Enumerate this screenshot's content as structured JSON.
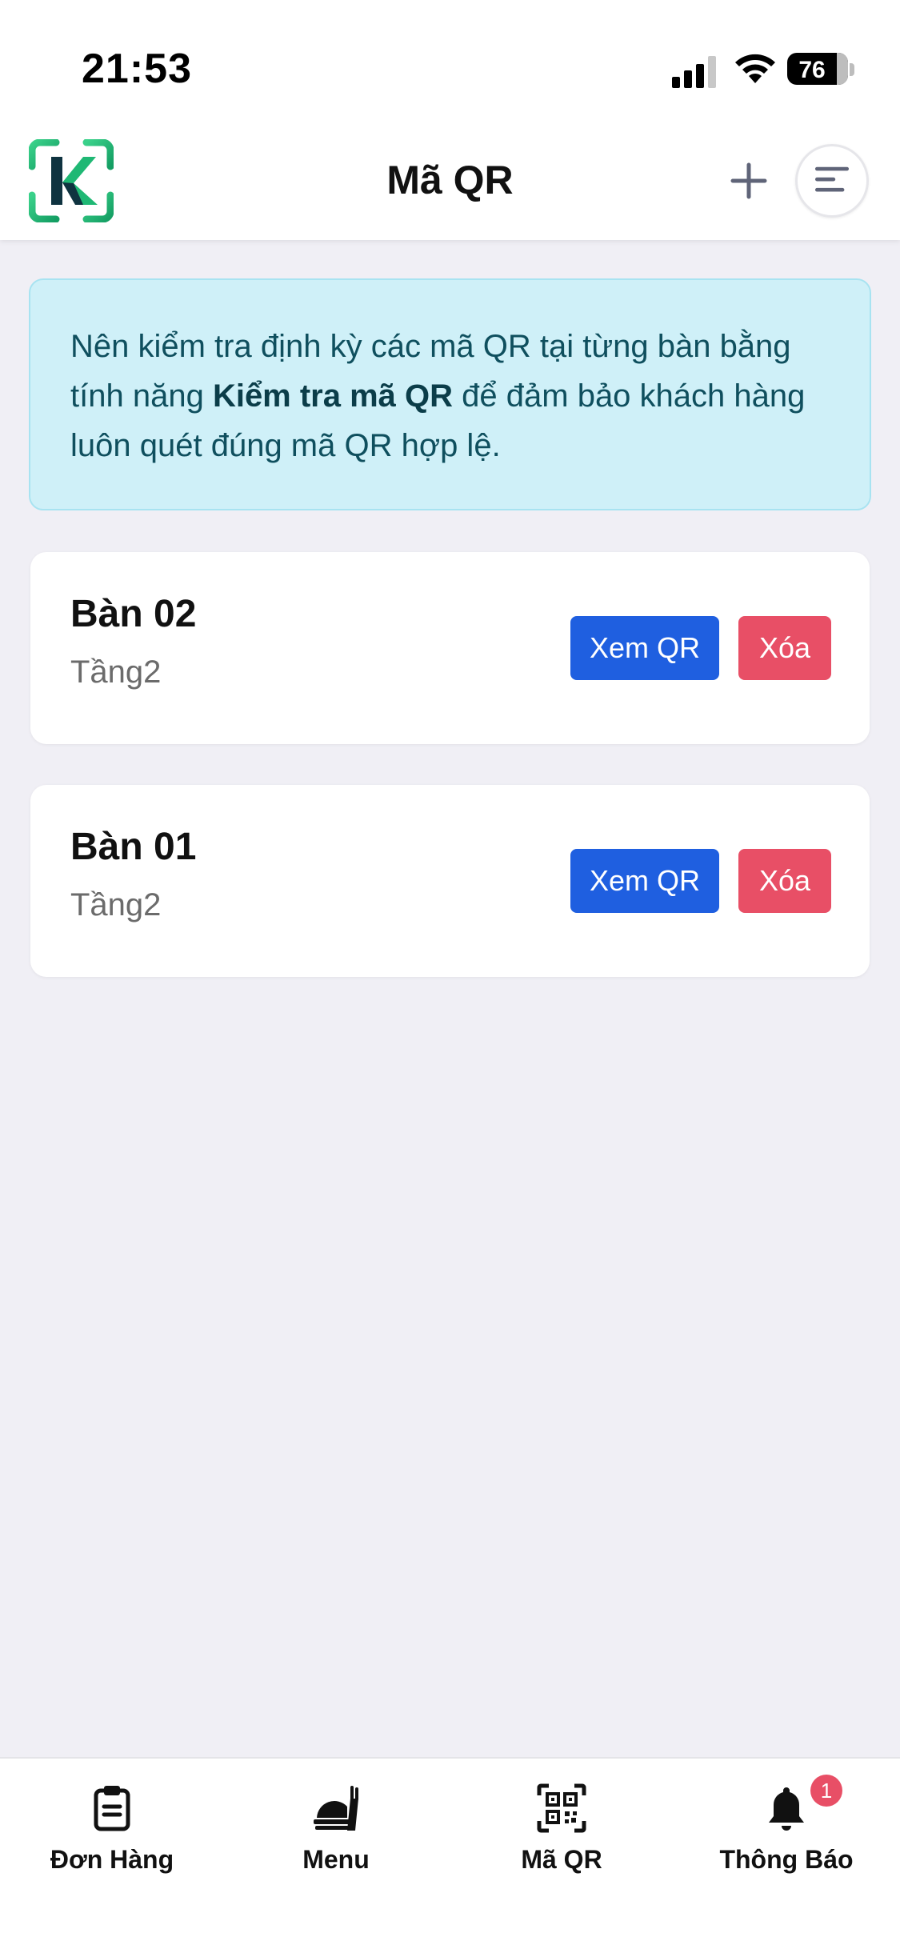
{
  "status_bar": {
    "time": "21:53",
    "battery": "76"
  },
  "header": {
    "title": "Mã QR",
    "logo_letter": "K"
  },
  "banner": {
    "text_before": "Nên kiểm tra định kỳ các mã QR tại từng bàn bằng tính năng ",
    "text_bold": "Kiểm tra mã QR",
    "text_after": " để đảm bảo khách hàng luôn quét đúng mã QR hợp lệ."
  },
  "tables": [
    {
      "name": "Bàn 02",
      "floor": "Tầng2",
      "view_label": "Xem QR",
      "delete_label": "Xóa"
    },
    {
      "name": "Bàn 01",
      "floor": "Tầng2",
      "view_label": "Xem QR",
      "delete_label": "Xóa"
    }
  ],
  "bottom_nav": {
    "items": [
      {
        "label": "Đơn Hàng",
        "icon": "clipboard-icon"
      },
      {
        "label": "Menu",
        "icon": "food-icon"
      },
      {
        "label": "Mã QR",
        "icon": "qr-code-icon"
      },
      {
        "label": "Thông Báo",
        "icon": "bell-icon",
        "badge": "1"
      }
    ]
  },
  "colors": {
    "primary": "#1f5fe0",
    "danger": "#e84f66",
    "banner_bg": "#cff0f8",
    "background": "#f0eff5",
    "logo_green": "#22c07a"
  }
}
